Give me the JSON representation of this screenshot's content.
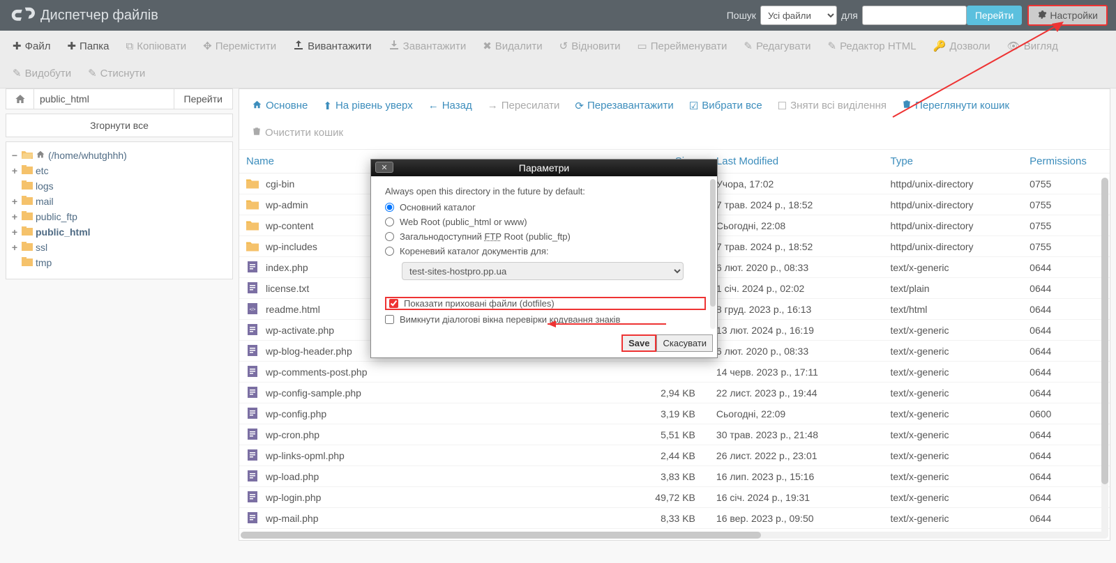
{
  "header": {
    "title": "Диспетчер файлів",
    "search_label": "Пошук",
    "search_scope": "Усі файли",
    "for_label": "для",
    "search_value": "",
    "go": "Перейти",
    "settings": "Настройки"
  },
  "toolbar": {
    "file": "Файл",
    "folder": "Папка",
    "copy": "Копіювати",
    "move": "Перемістити",
    "upload": "Вивантажити",
    "download": "Завантажити",
    "delete": "Видалити",
    "restore": "Відновити",
    "rename": "Перейменувати",
    "edit": "Редагувати",
    "htmlEditor": "Редактор HTML",
    "perms": "Дозволи",
    "view": "Вигляд",
    "extract": "Видобути",
    "compress": "Стиснути"
  },
  "path": {
    "value": "public_html",
    "go": "Перейти"
  },
  "collapse_all": "Згорнути все",
  "tree": {
    "root": "(/home/whutghhh)",
    "items": [
      "etc",
      "logs",
      "mail",
      "public_ftp",
      "public_html",
      "ssl",
      "tmp"
    ]
  },
  "actionbar": {
    "home": "Основне",
    "up": "На рівень уверх",
    "back": "Назад",
    "forward": "Пересилати",
    "reload": "Перезавантажити",
    "selectAll": "Вибрати все",
    "deselect": "Зняти всі виділення",
    "viewTrash": "Переглянути кошик",
    "emptyTrash": "Очистити кошик"
  },
  "columns": {
    "name": "Name",
    "size": "Size",
    "modified": "Last Modified",
    "type": "Type",
    "perm": "Permissions"
  },
  "files": [
    {
      "icon": "folder",
      "name": "cgi-bin",
      "size": "",
      "modified": "Учора, 17:02",
      "type": "httpd/unix-directory",
      "perm": "0755"
    },
    {
      "icon": "folder",
      "name": "wp-admin",
      "size": "",
      "modified": "7 трав. 2024 р., 18:52",
      "type": "httpd/unix-directory",
      "perm": "0755"
    },
    {
      "icon": "folder",
      "name": "wp-content",
      "size": "",
      "modified": "Сьогодні, 22:08",
      "type": "httpd/unix-directory",
      "perm": "0755"
    },
    {
      "icon": "folder",
      "name": "wp-includes",
      "size": "",
      "modified": "7 трав. 2024 р., 18:52",
      "type": "httpd/unix-directory",
      "perm": "0755"
    },
    {
      "icon": "file",
      "name": "index.php",
      "size": "",
      "modified": "6 лют. 2020 р., 08:33",
      "type": "text/x-generic",
      "perm": "0644"
    },
    {
      "icon": "file",
      "name": "license.txt",
      "size": "",
      "modified": "1 січ. 2024 р., 02:02",
      "type": "text/plain",
      "perm": "0644"
    },
    {
      "icon": "html",
      "name": "readme.html",
      "size": "",
      "modified": "8 груд. 2023 р., 16:13",
      "type": "text/html",
      "perm": "0644"
    },
    {
      "icon": "file",
      "name": "wp-activate.php",
      "size": "",
      "modified": "13 лют. 2024 р., 16:19",
      "type": "text/x-generic",
      "perm": "0644"
    },
    {
      "icon": "file",
      "name": "wp-blog-header.php",
      "size": "",
      "modified": "6 лют. 2020 р., 08:33",
      "type": "text/x-generic",
      "perm": "0644"
    },
    {
      "icon": "file",
      "name": "wp-comments-post.php",
      "size": "",
      "modified": "14 черв. 2023 р., 17:11",
      "type": "text/x-generic",
      "perm": "0644"
    },
    {
      "icon": "file",
      "name": "wp-config-sample.php",
      "size": "2,94 KB",
      "modified": "22 лист. 2023 р., 19:44",
      "type": "text/x-generic",
      "perm": "0644"
    },
    {
      "icon": "file",
      "name": "wp-config.php",
      "size": "3,19 KB",
      "modified": "Сьогодні, 22:09",
      "type": "text/x-generic",
      "perm": "0600"
    },
    {
      "icon": "file",
      "name": "wp-cron.php",
      "size": "5,51 KB",
      "modified": "30 трав. 2023 р., 21:48",
      "type": "text/x-generic",
      "perm": "0644"
    },
    {
      "icon": "file",
      "name": "wp-links-opml.php",
      "size": "2,44 KB",
      "modified": "26 лист. 2022 р., 23:01",
      "type": "text/x-generic",
      "perm": "0644"
    },
    {
      "icon": "file",
      "name": "wp-load.php",
      "size": "3,83 KB",
      "modified": "16 лип. 2023 р., 15:16",
      "type": "text/x-generic",
      "perm": "0644"
    },
    {
      "icon": "file",
      "name": "wp-login.php",
      "size": "49,72 KB",
      "modified": "16 січ. 2024 р., 19:31",
      "type": "text/x-generic",
      "perm": "0644"
    },
    {
      "icon": "file",
      "name": "wp-mail.php",
      "size": "8,33 KB",
      "modified": "16 вер. 2023 р., 09:50",
      "type": "text/x-generic",
      "perm": "0644"
    }
  ],
  "dialog": {
    "title": "Параметри",
    "heading": "Always open this directory in the future by default:",
    "opt_home": "Основний каталог",
    "opt_webroot": "Web Root (public_html or www)",
    "opt_ftp_pre": "Загальнодоступний ",
    "opt_ftp_link": "FTP",
    "opt_ftp_post": " Root (public_ftp)",
    "opt_docroot": "Кореневий каталог документів для:",
    "domain": "test-sites-hostpro.pp.ua",
    "chk_dotfiles": "Показати приховані файли (dotfiles)",
    "chk_encoding": "Вимкнути діалогові вікна перевірки кодування знаків",
    "save": "Save",
    "cancel": "Скасувати"
  }
}
